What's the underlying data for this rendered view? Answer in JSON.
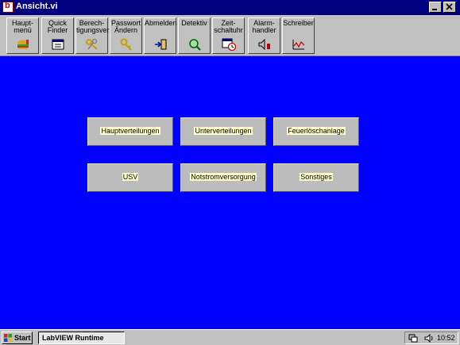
{
  "window": {
    "title": "Ansicht.vi",
    "title_bar_color": "#000080",
    "controls": [
      "minimize-icon",
      "maximize-icon",
      "close-icon"
    ]
  },
  "toolbar": {
    "buttons": [
      {
        "label": "Haupt-\nmenü",
        "icon": "burger-menu-icon"
      },
      {
        "label": "Quick\nFinder",
        "icon": "finder-window-icon"
      },
      {
        "label": "Berech-\ntigungsver.",
        "icon": "keys-icon"
      },
      {
        "label": "Passwort\nÄndern",
        "icon": "key-icon"
      },
      {
        "label": "Abmelden",
        "icon": "logout-arrow-icon"
      },
      {
        "label": "Detektiv",
        "icon": "magnifier-icon"
      },
      {
        "label": "Zeit-\nschaltuhr",
        "icon": "calendar-clock-icon"
      },
      {
        "label": "Alarm-\nhandler",
        "icon": "speaker-alarm-icon"
      },
      {
        "label": "Schreiber",
        "icon": "chart-recorder-icon"
      }
    ]
  },
  "main": {
    "background": "#0000ff",
    "buttons": [
      {
        "label": "Hauptverteilungen"
      },
      {
        "label": "Unterverteilungen"
      },
      {
        "label": "Feuerlöschanlage"
      },
      {
        "label": "USV"
      },
      {
        "label": "Notstromversorgung"
      },
      {
        "label": "Sonstiges"
      }
    ]
  },
  "taskbar": {
    "start_label": "Start",
    "task_label": "LabVIEW Runtime",
    "clock": "10:52",
    "tray_icons": [
      "network-icon",
      "speaker-icon"
    ]
  }
}
